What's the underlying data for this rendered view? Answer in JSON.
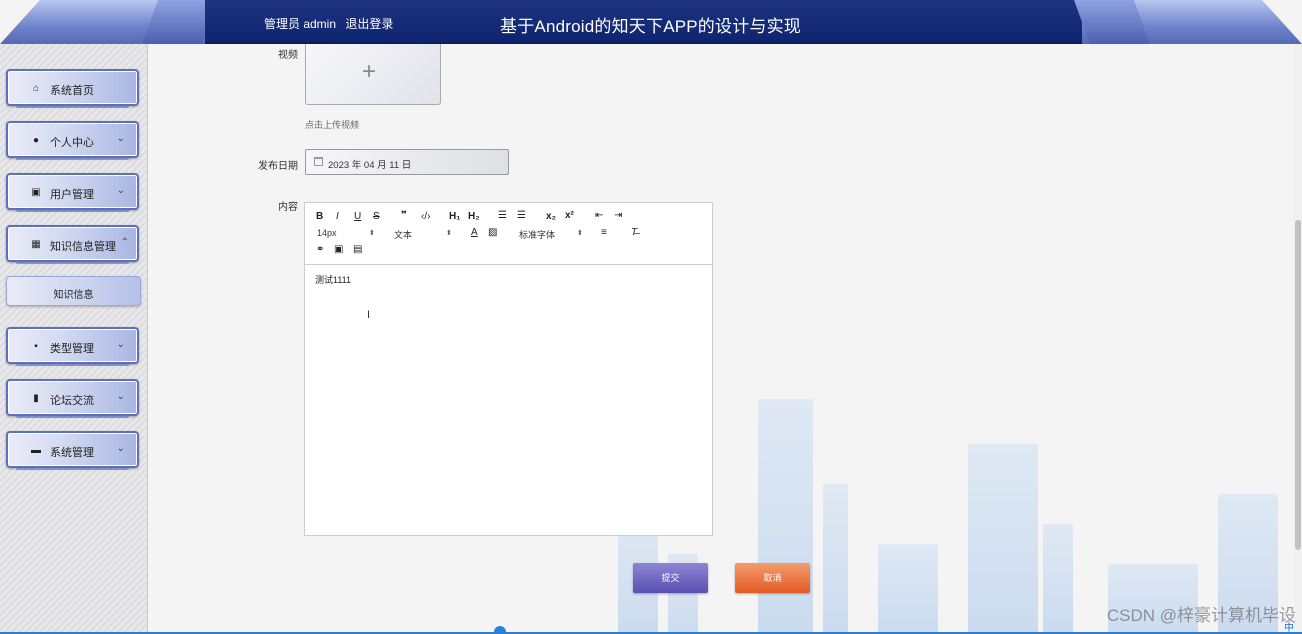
{
  "header": {
    "admin_label": "管理员 admin",
    "logout_label": "退出登录",
    "app_title": "基于Android的知天下APP的设计与实现"
  },
  "sidebar": {
    "items": [
      {
        "label": "系统首页",
        "icon": "home-icon",
        "expandable": false
      },
      {
        "label": "个人中心",
        "icon": "user-icon",
        "expandable": true
      },
      {
        "label": "用户管理",
        "icon": "chart-icon",
        "expandable": true
      },
      {
        "label": "知识信息管理",
        "icon": "grid-icon",
        "expandable": true,
        "expanded": true
      },
      {
        "label": "类型管理",
        "icon": "apps-icon",
        "expandable": true
      },
      {
        "label": "论坛交流",
        "icon": "bar-chart-icon",
        "expandable": true
      },
      {
        "label": "系统管理",
        "icon": "briefcase-icon",
        "expandable": true
      }
    ],
    "sub_item": "知识信息"
  },
  "form": {
    "video_label": "视频",
    "upload_hint": "点击上传视频",
    "date_label": "发布日期",
    "date_value": "2023 年 04 月 11 日",
    "content_label": "内容",
    "content_text": "测试1111",
    "submit_label": "提交",
    "cancel_label": "取消"
  },
  "editor_toolbar": {
    "font_size": "14px",
    "text_type": "文本",
    "font_family": "标准字体"
  },
  "watermark": "CSDN @梓豪计算机毕设",
  "ime": "中",
  "colors": {
    "header_center": "#0e2470",
    "submit": "#5a4fb0",
    "cancel": "#e35b24",
    "nav_border": "#5b6fbe"
  }
}
